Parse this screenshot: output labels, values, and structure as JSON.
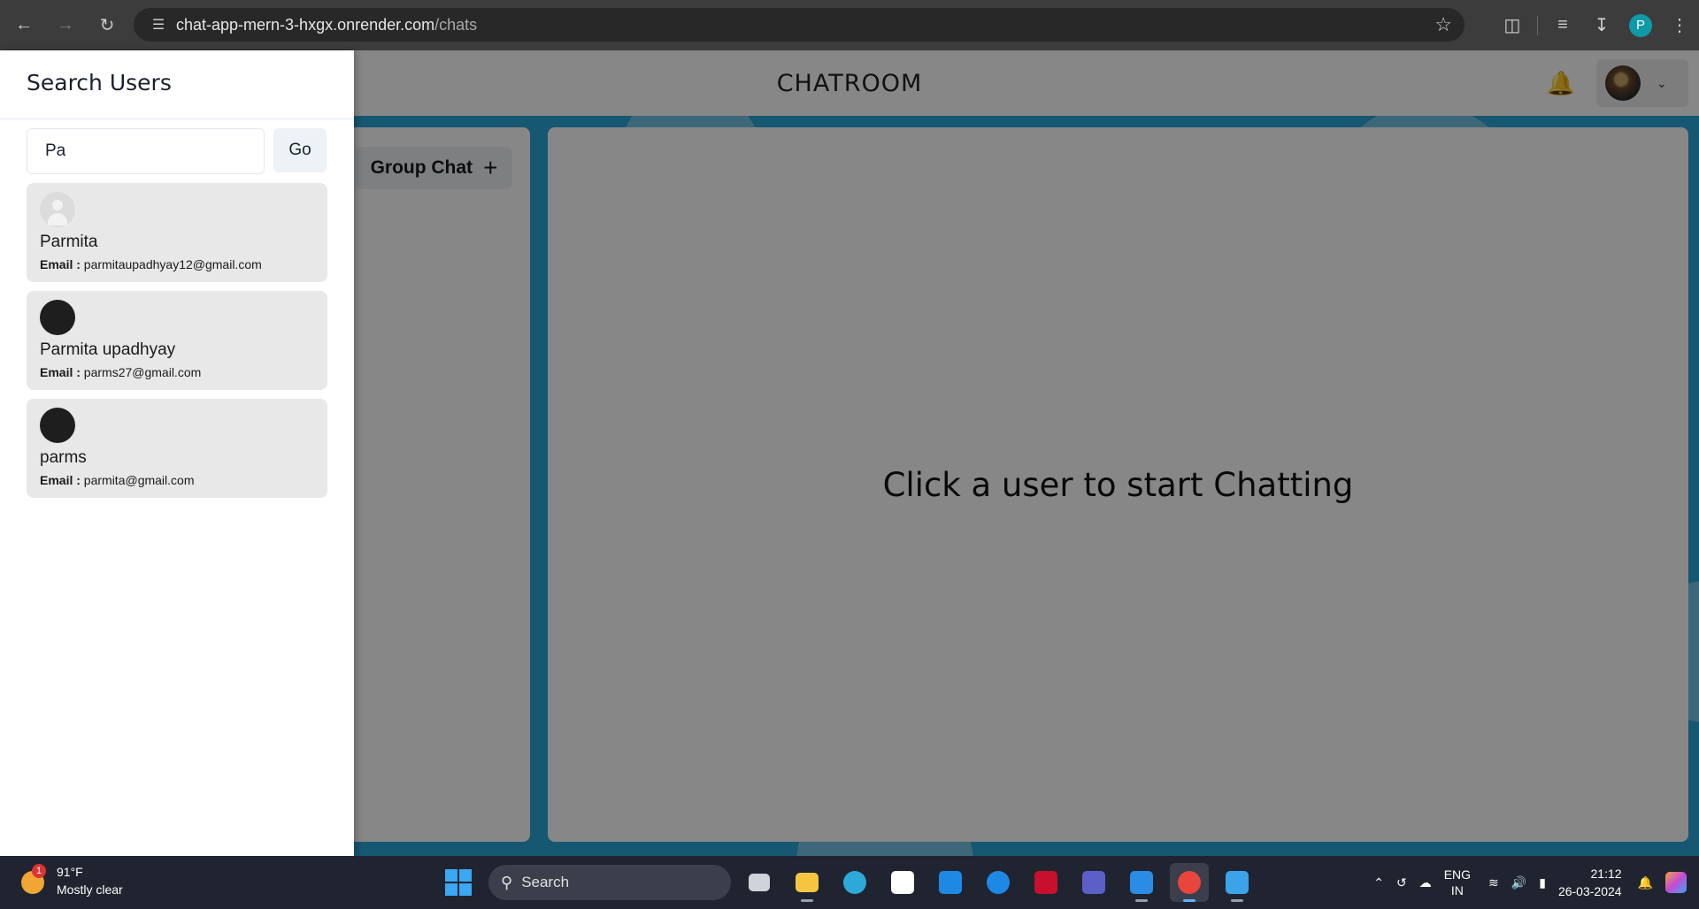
{
  "browser": {
    "url_host": "chat-app-mern-3-hxgx.onrender.com",
    "url_path": "/chats",
    "profile_initial": "P"
  },
  "app": {
    "title": "CHATROOM",
    "group_chat_label": "Group Chat",
    "chat_placeholder": "Click a user to start Chatting"
  },
  "drawer": {
    "title": "Search Users",
    "search_value": "Pa",
    "go_label": "Go",
    "email_label": "Email :",
    "results": [
      {
        "name": "Parmita",
        "email": "parmitaupadhyay12@gmail.com",
        "avatar": "default"
      },
      {
        "name": "Parmita upadhyay",
        "email": "parms27@gmail.com",
        "avatar": "dark"
      },
      {
        "name": "parms",
        "email": "parmita@gmail.com",
        "avatar": "dark"
      }
    ]
  },
  "taskbar": {
    "weather_badge": "1",
    "temperature": "91°F",
    "weather_desc": "Mostly clear",
    "search_label": "Search",
    "lang_top": "ENG",
    "lang_bottom": "IN",
    "time": "21:12",
    "date": "26-03-2024"
  },
  "colors": {
    "app_background": "#2aa5d6",
    "profile_dot": "#0e9aa7",
    "windows_blue": "#3aa8f2"
  }
}
